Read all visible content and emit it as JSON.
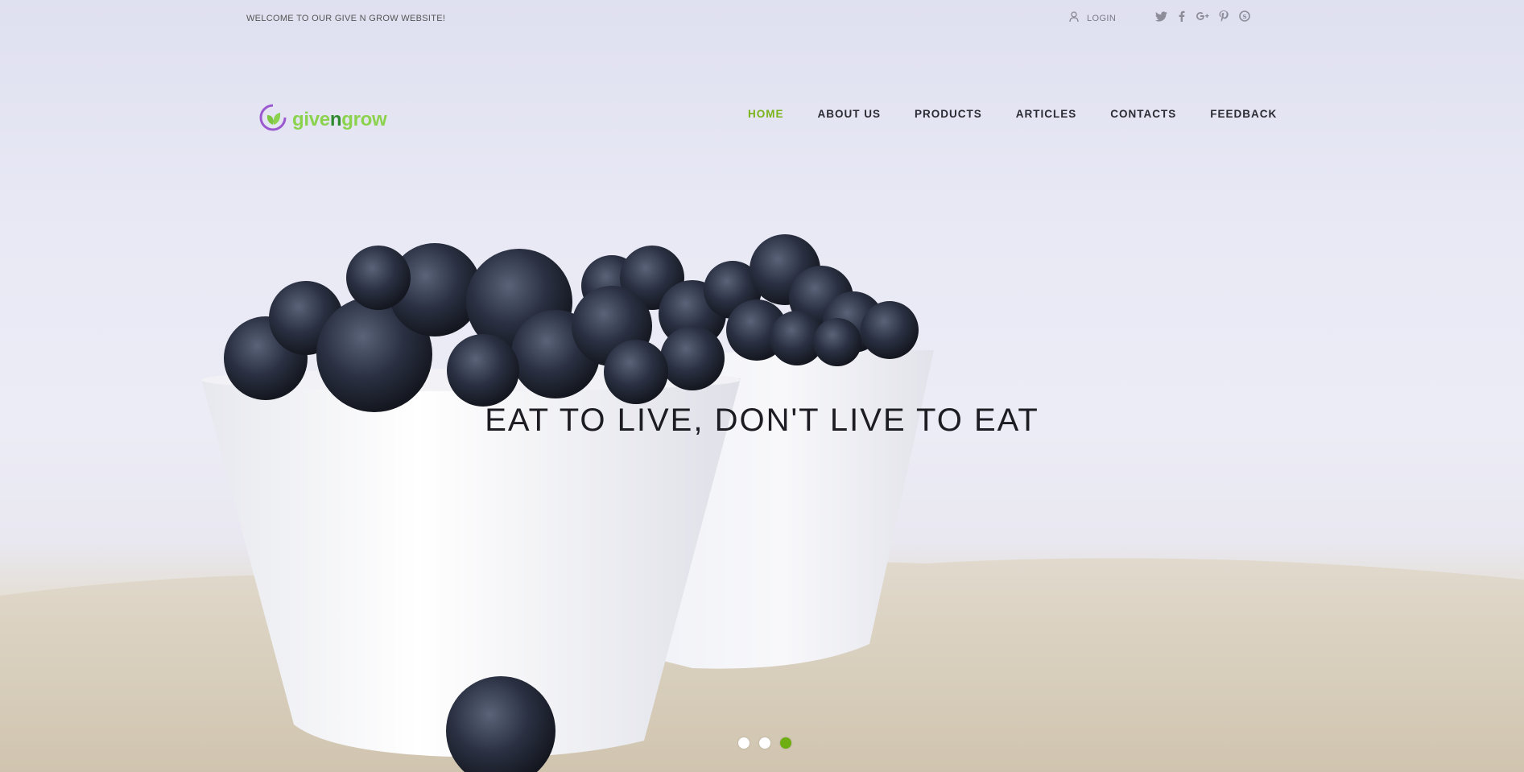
{
  "topbar": {
    "welcome": "WELCOME TO OUR GIVE N GROW WEBSITE!",
    "login_label": "LOGIN",
    "social": [
      "twitter-icon",
      "facebook-icon",
      "google-plus-icon",
      "pinterest-icon",
      "skype-icon"
    ]
  },
  "logo": {
    "part1": "give",
    "part2": "n",
    "part3": "grow"
  },
  "nav": {
    "items": [
      {
        "label": "HOME",
        "active": true
      },
      {
        "label": "ABOUT US",
        "active": false
      },
      {
        "label": "PRODUCTS",
        "active": false
      },
      {
        "label": "ARTICLES",
        "active": false
      },
      {
        "label": "CONTACTS",
        "active": false
      },
      {
        "label": "FEEDBACK",
        "active": false
      }
    ]
  },
  "hero": {
    "headline": "EAT TO LIVE, DON'T LIVE TO EAT"
  },
  "slider": {
    "count": 3,
    "active_index": 2
  },
  "colors": {
    "accent": "#7ab317",
    "logo_green": "#8bd34e",
    "logo_purple": "#9b59d0"
  }
}
